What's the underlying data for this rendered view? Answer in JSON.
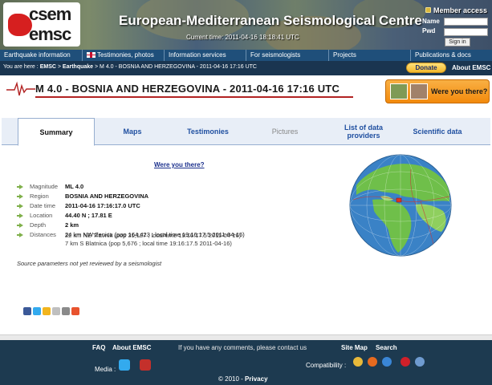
{
  "header": {
    "logo_line1": "csem",
    "logo_line2": "emsc",
    "site_title": "European-Mediterranean Seismological Centre",
    "current_time": "Current time: 2011-04-16 18:18:41 UTC"
  },
  "login": {
    "title": "Member access",
    "name_label": "Name",
    "pwd_label": "Pwd",
    "name_value": "",
    "pwd_value": "",
    "signin_label": "Sign in"
  },
  "mainnav": {
    "items": [
      {
        "label": "Earthquake information"
      },
      {
        "label": "Testimonies, photos"
      },
      {
        "label": "Information services"
      },
      {
        "label": "For seismologists"
      },
      {
        "label": "Projects"
      },
      {
        "label": "Publications & docs"
      }
    ]
  },
  "breadcrumb": {
    "prefix": "You are here :",
    "emsc": "EMSC",
    "sep1": ">",
    "earthquake": "Earthquake",
    "sep2": ">",
    "current": "M 4.0 - BOSNIA AND HERZEGOVINA - 2011-04-16 17:16 UTC"
  },
  "topright": {
    "donate_label": "Donate",
    "about_label": "About EMSC"
  },
  "event": {
    "title": "M 4.0 - BOSNIA AND HERZEGOVINA - 2011-04-16 17:16 UTC",
    "were_you_there_button": "Were you there?"
  },
  "tabs": [
    {
      "label": "Summary",
      "active": true
    },
    {
      "label": "Maps"
    },
    {
      "label": "Testimonies"
    },
    {
      "label": "Pictures",
      "disabled": true
    },
    {
      "label": "List of data providers"
    },
    {
      "label": "Scientific data"
    }
  ],
  "summary": {
    "were_link": "Were you there?",
    "params": [
      {
        "key": "Magnitude",
        "value": "ML 4.0",
        "bold": true
      },
      {
        "key": "Region",
        "value": "BOSNIA AND HERZEGOVINA",
        "bold": true
      },
      {
        "key": "Date time",
        "value": "2011-04-16 17:16:17.0 UTC",
        "bold": true
      },
      {
        "key": "Location",
        "value": "44.40 N ; 17.81 E",
        "bold": true
      },
      {
        "key": "Depth",
        "value": "2 km",
        "bold": true
      },
      {
        "key": "Distances",
        "value": "24 km NW Zenica (pop 164,423 ; local time 19:16:17.5 2011-04-16)",
        "bold": false
      }
    ],
    "distances_extra": [
      "22 km NE Travnik (pop 31,127 ; local time 19:16:17.5 2011-04-16)",
      "7 km S Blatnica (pop 5,676 ; local time 19:16:17.5 2011-04-16)"
    ],
    "note": "Source parameters not yet reviewed by a seismologist"
  },
  "share_icons": [
    "facebook-icon",
    "twitter-icon",
    "favorite-icon",
    "email-icon",
    "print-icon",
    "plus-icon"
  ],
  "footer": {
    "faq": "FAQ",
    "about": "About EMSC",
    "comments": "If you have any comments, please contact us",
    "sitemap": "Site Map",
    "search": "Search",
    "media_label": "Media :",
    "compat_label": "Compatibility :",
    "copyright": "© 2010 -",
    "privacy": "Privacy"
  },
  "colors": {
    "nav_blue": "#1f4f7a",
    "footer_blue": "#1d3a50",
    "tab_link": "#1f4fa0",
    "accent_red": "#b22222",
    "orange_button": "#f28a0c"
  }
}
